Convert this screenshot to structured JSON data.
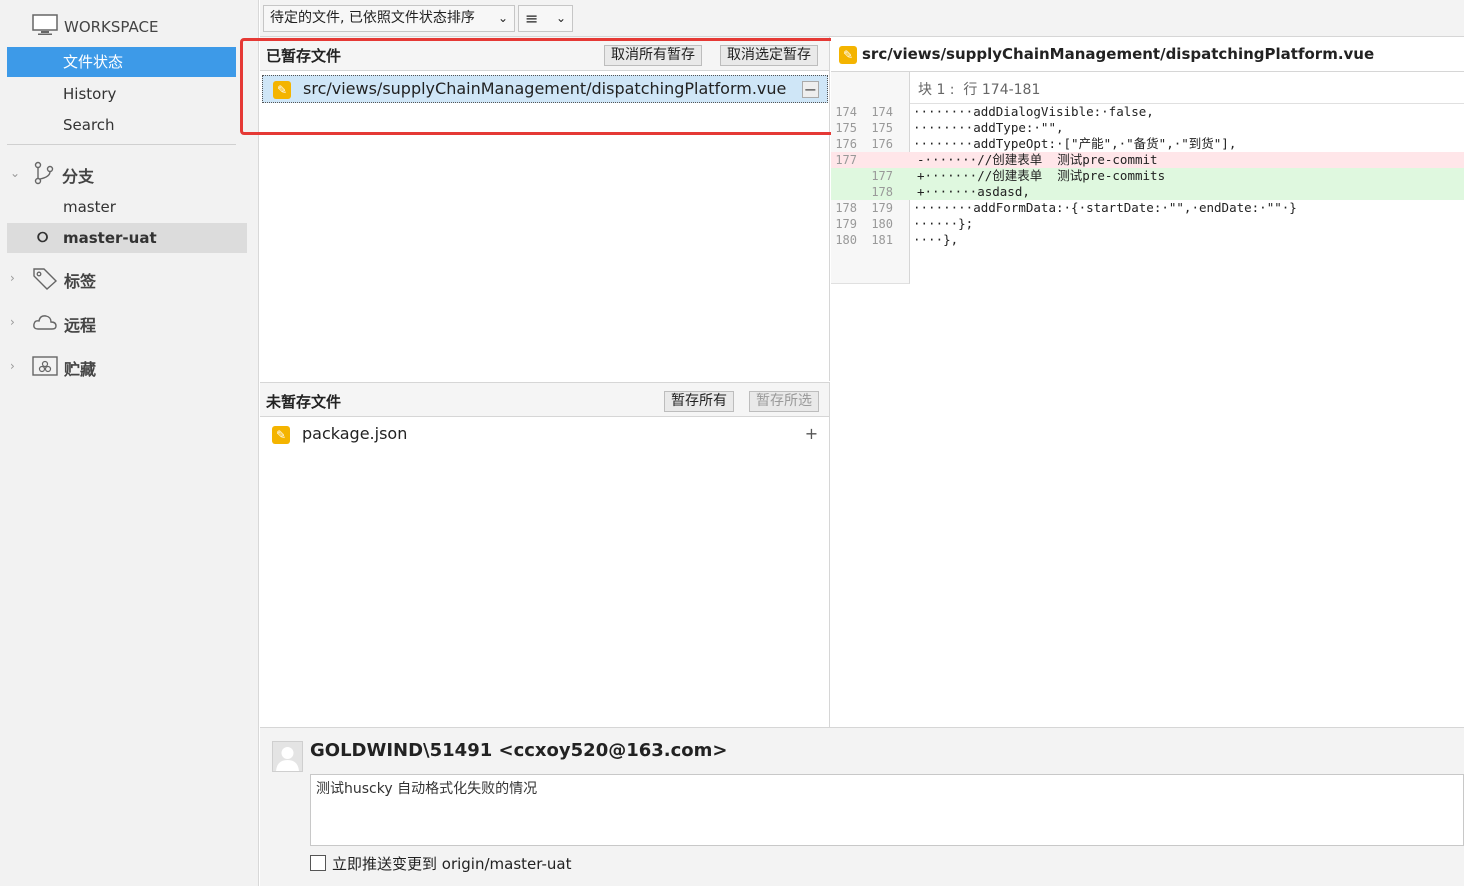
{
  "sidebar": {
    "workspace": "WORKSPACE",
    "items": [
      {
        "label": "文件状态"
      },
      {
        "label": "History"
      },
      {
        "label": "Search"
      }
    ],
    "branches_label": "分支",
    "branches": [
      "master",
      "master-uat"
    ],
    "tags_label": "标签",
    "remotes_label": "远程",
    "stashes_label": "贮藏"
  },
  "toolbar": {
    "sort_label": "待定的文件, 已依照文件状态排序",
    "view_icon": "≡"
  },
  "staged": {
    "title": "已暂存文件",
    "unstage_all": "取消所有暂存",
    "unstage_selected": "取消选定暂存",
    "files": [
      {
        "path": "src/views/supplyChainManagement/dispatchingPlatform.vue"
      }
    ]
  },
  "unstaged": {
    "title": "未暂存文件",
    "stage_all": "暂存所有",
    "stage_selected": "暂存所选",
    "files": [
      {
        "path": "package.json"
      }
    ]
  },
  "diff": {
    "file": "src/views/supplyChainManagement/dispatchingPlatform.vue",
    "hunk": "块 1 :  行 174-181",
    "lines": [
      {
        "old": "174",
        "new": "174",
        "text": "········addDialogVisible:·false,",
        "type": "ctx"
      },
      {
        "old": "175",
        "new": "175",
        "text": "········addType:·\"\",",
        "type": "ctx"
      },
      {
        "old": "176",
        "new": "176",
        "text": "········addTypeOpt:·[\"产能\",·\"备货\",·\"到货\"],",
        "type": "ctx"
      },
      {
        "old": "177",
        "new": "",
        "text": "-·······//创建表单  测试pre-commit",
        "type": "del"
      },
      {
        "old": "",
        "new": "177",
        "text": "+·······//创建表单  测试pre-commits",
        "type": "add"
      },
      {
        "old": "",
        "new": "178",
        "text": "+·······asdasd,",
        "type": "add"
      },
      {
        "old": "178",
        "new": "179",
        "text": "········addFormData:·{·startDate:·\"\",·endDate:·\"\"·}",
        "type": "ctx"
      },
      {
        "old": "179",
        "new": "180",
        "text": "······};",
        "type": "ctx"
      },
      {
        "old": "180",
        "new": "181",
        "text": "····},",
        "type": "ctx"
      }
    ]
  },
  "commit": {
    "author": "GOLDWIND\\51491 <ccxoy520@163.com>",
    "message": "测试huscky 自动格式化失败的情况",
    "push_label": "立即推送变更到 origin/master-uat"
  },
  "colors": {
    "selection": "#3d9ae8",
    "highlight": "#e53935",
    "modified_icon": "#f4b400"
  }
}
